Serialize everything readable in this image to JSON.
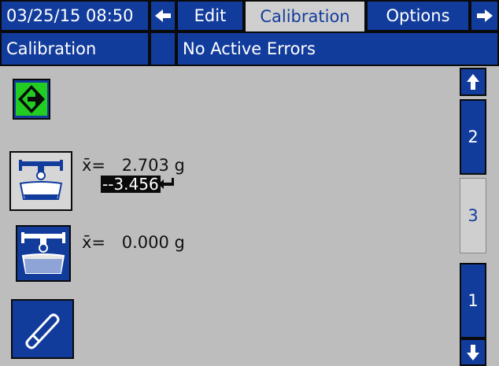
{
  "header": {
    "datetime": "03/25/15 08:50",
    "tabs": [
      {
        "label": "Edit"
      },
      {
        "label": "Calibration"
      },
      {
        "label": "Options"
      }
    ],
    "nav_left_icon": "arrow-left-icon",
    "nav_right_icon": "arrow-right-icon"
  },
  "status": {
    "screen_name": "Calibration",
    "message": "No Active Errors"
  },
  "calibration": {
    "start_icon": "start-diamond-icon",
    "reading1": {
      "label": "x̄=",
      "value": "2.703 g"
    },
    "input_value": "--3.456",
    "enter_icon": "enter-icon",
    "reading2": {
      "label": "x̄=",
      "value": "0.000 g"
    },
    "scale_icon_1": "scale-cup-icon",
    "scale_icon_2": "scale-fill-icon",
    "erase_icon": "eraser-icon"
  },
  "pager": {
    "up_icon": "arrow-up-icon",
    "pages": [
      "2",
      "3",
      "1"
    ],
    "current_page": "3",
    "down_icon": "arrow-down-icon"
  },
  "colors": {
    "accent_blue": "#123c9c",
    "background_gray": "#bdbdbd",
    "start_green": "#22cc22",
    "input_black": "#0a0a0a"
  }
}
